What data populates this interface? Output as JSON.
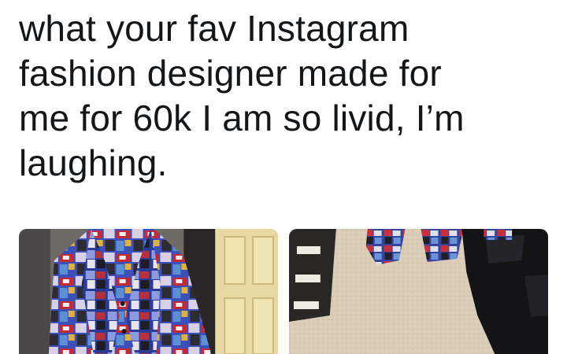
{
  "tweet": {
    "text_lines": [
      "what your fav Instagram",
      "fashion designer made for",
      "me for 60k I am so livid, I’m",
      "laughing."
    ]
  },
  "media": {
    "photos": [
      {
        "icon": "shirt-photo"
      },
      {
        "icon": "floor-clothes-photo"
      }
    ]
  }
}
